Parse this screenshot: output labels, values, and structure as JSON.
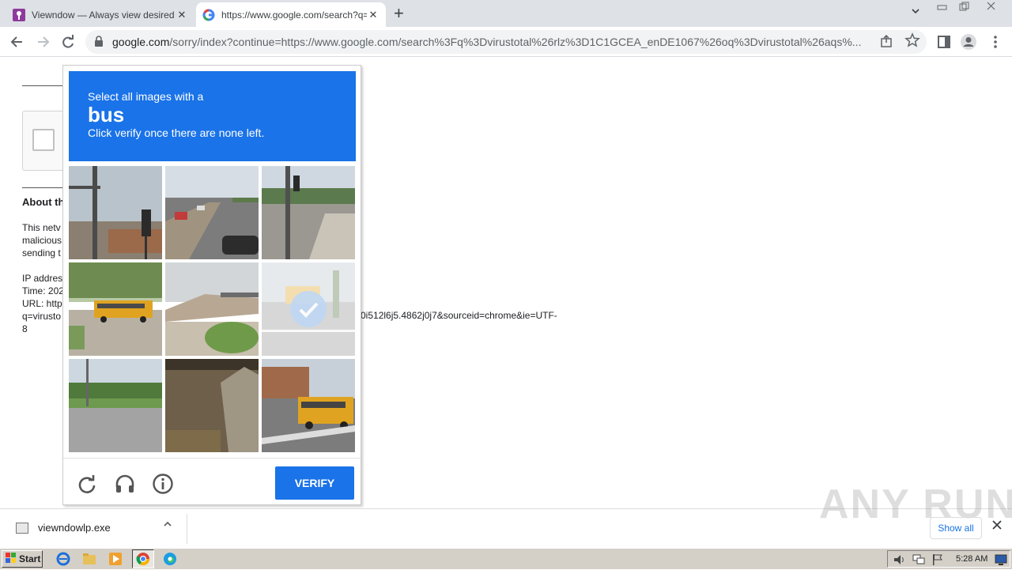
{
  "browser": {
    "tabs": [
      {
        "title": "Viewndow — Always view desired wi",
        "active": false
      },
      {
        "title": "https://www.google.com/search?q=",
        "active": true
      }
    ],
    "new_tab_glyph": "+",
    "tab_close_glyph": "✕",
    "url_host": "google.com",
    "url_rest": "/sorry/index?continue=https://www.google.com/search%3Fq%3Dvirustotal%26rlz%3D1C1GCEA_enDE1067%26oq%3Dvirustotal%26aqs%..."
  },
  "page": {
    "about_heading": "About th",
    "paragraph1": [
      "This netv",
      "malicious",
      "sending t"
    ],
    "paragraph2": [
      "IP addres",
      "Time: 202",
      "URL: http",
      "q=virusto",
      "8"
    ],
    "url_tail": "0i512l6j5.4862j0j7&sourceid=chrome&ie=UTF-"
  },
  "captcha": {
    "instruction_line1": "Select all images with a",
    "target_word": "bus",
    "instruction_line3": "Click verify once there are none left.",
    "verify_label": "VERIFY",
    "tiles": [
      {
        "subject": "traffic-light-street",
        "selected": false
      },
      {
        "subject": "highway-cars",
        "selected": false
      },
      {
        "subject": "sidewalk-corner",
        "selected": false
      },
      {
        "subject": "school-bus-road",
        "selected": false
      },
      {
        "subject": "overpass-bridge",
        "selected": false
      },
      {
        "subject": "bus-parking",
        "selected": true
      },
      {
        "subject": "empty-road",
        "selected": false
      },
      {
        "subject": "underpass-wall",
        "selected": false
      },
      {
        "subject": "school-bus-intersection",
        "selected": false
      }
    ]
  },
  "download_bar": {
    "filename": "viewndowlp.exe",
    "show_all_label": "Show all"
  },
  "watermark": "ANY RUN",
  "taskbar": {
    "start_label": "Start",
    "clock": "5:28 AM"
  },
  "colors": {
    "accent": "#1a73e8",
    "tabstrip": "#dee1e6",
    "taskbar": "#d4d0c8"
  }
}
